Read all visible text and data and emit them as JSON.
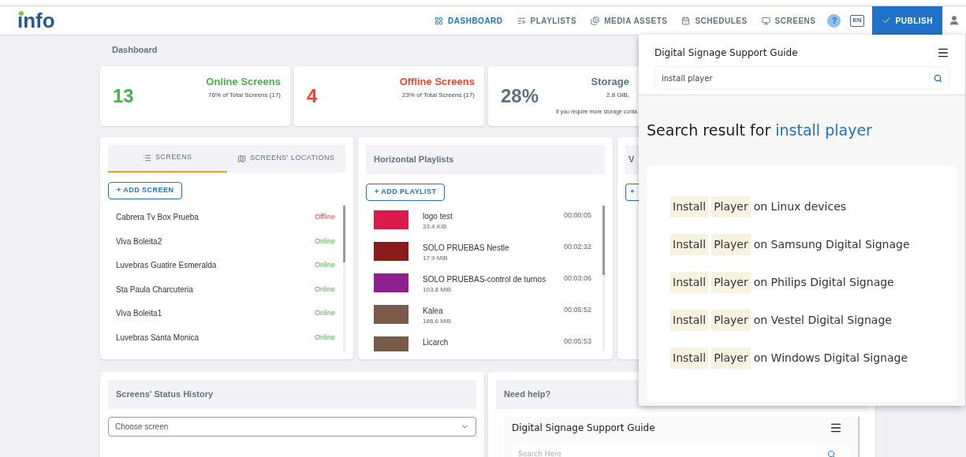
{
  "logo": "info",
  "nav": [
    {
      "label": "DASHBOARD",
      "selected": true
    },
    {
      "label": "PLAYLISTS",
      "selected": false
    },
    {
      "label": "MEDIA ASSETS",
      "selected": false
    },
    {
      "label": "SCHEDULES",
      "selected": false
    },
    {
      "label": "SCREENS",
      "selected": false
    }
  ],
  "help_button": "?",
  "language": "EN",
  "publish_button": "PUBLISH",
  "page_title": "Dashboard",
  "stats": [
    {
      "kind": "online",
      "title": "Online Screens",
      "value": "13",
      "note": "76% of Total Screens (17)"
    },
    {
      "kind": "offline",
      "title": "Offline Screens",
      "value": "4",
      "note": "23% of Total Screens (17)"
    },
    {
      "kind": "storage",
      "title": "Storage",
      "value": "28%",
      "detail": "2.8 GiB,",
      "note": "If you require more storage conta"
    }
  ],
  "screens_panel": {
    "tabs": [
      {
        "label": "SCREENS",
        "selected": true
      },
      {
        "label": "SCREENS' LOCATIONS",
        "selected": false
      }
    ],
    "add_button": "+ ADD SCREEN",
    "screens": [
      {
        "name": "Cabrera Tv Box Prueba",
        "status": "Offline",
        "online": false
      },
      {
        "name": "Viva Boleita2",
        "status": "Online",
        "online": true
      },
      {
        "name": "Luvebras Guatire Esmeralda",
        "status": "Online",
        "online": true
      },
      {
        "name": "Sta Paula Charcuteria",
        "status": "Online",
        "online": true
      },
      {
        "name": "Viva Boleita1",
        "status": "Online",
        "online": true
      },
      {
        "name": "Luvebras Santa Monica",
        "status": "Online",
        "online": true
      }
    ]
  },
  "playlists_panel": {
    "title": "Horizontal Playlists",
    "add_button": "+ ADD PLAYLIST",
    "playlists": [
      {
        "name": "logo test",
        "size": "33.4 KiB",
        "duration": "00:00:05",
        "color": "#d81b4a"
      },
      {
        "name": "SOLO PRUEBAS Nestle",
        "size": "17.9 MiB",
        "duration": "00:02:32",
        "color": "#8b1a1a"
      },
      {
        "name": "SOLO PRUEBAS-control de turnos",
        "size": "103.8 MiB",
        "duration": "00:03:06",
        "color": "#8e1f8e"
      },
      {
        "name": "Kalea",
        "size": "186.6 MiB",
        "duration": "00:05:52",
        "color": "#7a5a48"
      },
      {
        "name": "Licarch",
        "duration": "00:05:53",
        "color": "#7a5a48"
      }
    ]
  },
  "third_panel": {
    "title": "V",
    "add_button": "+"
  },
  "status_history": {
    "title": "Screens' Status History",
    "select_placeholder": "Choose screen"
  },
  "help_panel": {
    "title": "Need help?",
    "guide_title": "Digital Signage Support Guide",
    "search_placeholder": "Search Here"
  },
  "support_popup": {
    "title": "Digital Signage Support Guide",
    "search_value": "install player",
    "heading": "Search result for",
    "query": "install player",
    "results": [
      {
        "highlights": [
          "Install",
          "Player"
        ],
        "rest": "on Linux devices"
      },
      {
        "highlights": [
          "Install",
          "Player"
        ],
        "rest": "on Samsung Digital Signage"
      },
      {
        "highlights": [
          "Install",
          "Player"
        ],
        "rest": "on Philips Digital Signage"
      },
      {
        "highlights": [
          "Install",
          "Player"
        ],
        "rest": "on Vestel Digital Signage"
      },
      {
        "highlights": [
          "Install",
          "Player"
        ],
        "rest": "on Windows Digital Signage"
      }
    ]
  }
}
